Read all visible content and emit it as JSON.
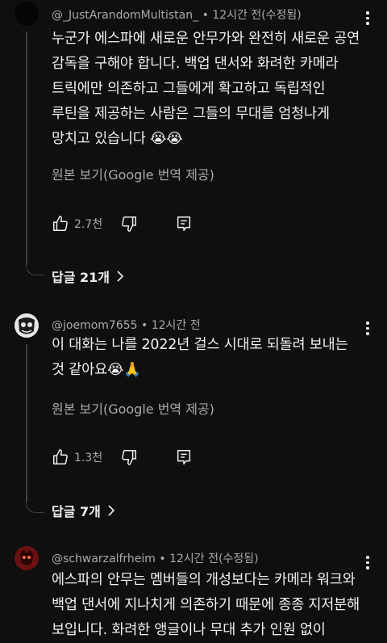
{
  "comments": [
    {
      "username": "@_JustArandomMultistan_",
      "time": "12시간 전(수정됨)",
      "lines": [
        "누군가 에스파에 새로운 안무가와 완전히 새로운 공연",
        "감독을 구해야 합니다. 백업 댄서와 화려한 카메라",
        "트릭에만 의존하고 그들에게 확고하고 독립적인",
        "루틴을 제공하는 사람은 그들의 무대를 엄청나게",
        "망치고 있습니다 😭😭"
      ],
      "translate_label": "원본 보기(Google 번역 제공)",
      "likes": "2.7천",
      "replies_label": "답글 21개"
    },
    {
      "username": "@joemom7655",
      "time": "12시간 전",
      "lines": [
        "이 대화는 나를 2022년 걸스 시대로 되돌려 보내는",
        "것 같아요😭🙏"
      ],
      "translate_label": "원본 보기(Google 번역 제공)",
      "likes": "1.3천",
      "replies_label": "답글 7개"
    },
    {
      "username": "@schwarzalfrheim",
      "time": "12시간 전(수정됨)",
      "lines": [
        "에스파의 안무는 멤버들의 개성보다는 카메라 워크와",
        "백업 댄서에 지나치게 의존하기 때문에 종종 지저분해",
        "보입니다. 화려한 앵글이나 무대 추가 인원 없이"
      ]
    }
  ],
  "separator": " • ",
  "colors": {
    "background": "#0f0f0f",
    "text": "#f1f1f1",
    "secondary": "#aaaaaa",
    "thread": "#3f3f3f"
  },
  "icons": [
    "thumb-up-icon",
    "thumb-down-icon",
    "reply-comment-icon",
    "more-vert-icon",
    "chevron-right-icon"
  ]
}
